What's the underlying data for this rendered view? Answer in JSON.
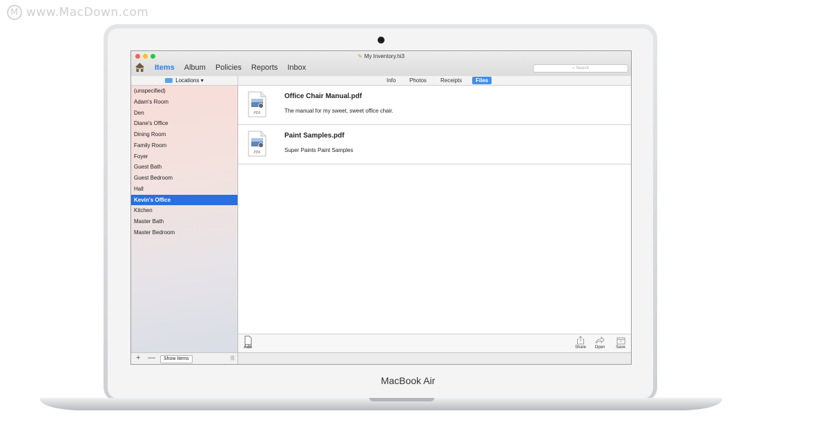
{
  "watermark": {
    "text": "www.MacDown.com"
  },
  "device": {
    "brand": "MacBook Air"
  },
  "window": {
    "title": "My Inventory.hi3",
    "search_placeholder": "Search"
  },
  "nav": {
    "items": [
      "Items",
      "Album",
      "Policies",
      "Reports",
      "Inbox"
    ],
    "active": "Items"
  },
  "sidebar": {
    "header": "Locations ▾",
    "items": [
      "(unspecified)",
      "Adam's Room",
      "Den",
      "Diane's Office",
      "Dining Room",
      "Family Room",
      "Foyer",
      "Guest Bath",
      "Guest Bedroom",
      "Hall",
      "Kevin's Office",
      "Kitchen",
      "Master Bath",
      "Master Bedroom"
    ],
    "selected": "Kevin's Office",
    "footer": {
      "add": "+",
      "remove": "—",
      "show_items": "Show Items"
    }
  },
  "detail_tabs": {
    "items": [
      "Info",
      "Photos",
      "Receipts",
      "Files"
    ],
    "active": "Files"
  },
  "files": [
    {
      "name": "Office Chair Manual.pdf",
      "description": "The manual for my sweet, sweet office chair.",
      "icon_label": "PDF"
    },
    {
      "name": "Paint Samples.pdf",
      "description": "Super Paints Paint Samples",
      "icon_label": "PDF"
    }
  ],
  "toolbar": {
    "add": "Add",
    "share": "Share",
    "open": "Open",
    "save": "Save"
  },
  "colors": {
    "accent": "#2d7de6",
    "selection": "#2a6fe0",
    "tab_active": "#3b8ff0"
  },
  "icons": {
    "home": "house-icon",
    "folder": "folder-icon",
    "file": "pdf-file-icon"
  }
}
